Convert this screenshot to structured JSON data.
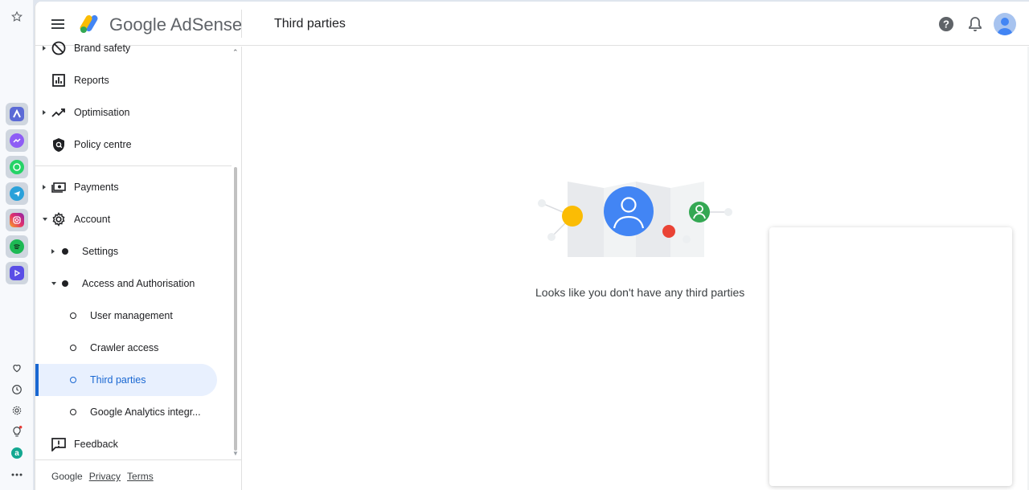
{
  "rail": {
    "apps": [
      {
        "icon": "adsense-app-icon",
        "color": "#5b6ad6"
      },
      {
        "icon": "messenger-icon",
        "color": "#8e5df5"
      },
      {
        "icon": "whatsapp-icon",
        "color": "#25d366"
      },
      {
        "icon": "telegram-icon",
        "color": "#2aa1da"
      },
      {
        "icon": "instagram-icon",
        "color": "#e1306c"
      },
      {
        "icon": "spotify-icon",
        "color": "#1db954"
      },
      {
        "icon": "player-icon",
        "color": "#5a4ee6"
      }
    ],
    "tools": [
      "heart-icon",
      "history-icon",
      "settings-icon",
      "bulb-icon",
      "aria-icon",
      "more-icon"
    ]
  },
  "header": {
    "brand": "Google AdSense",
    "page_title": "Third parties",
    "help_icon": "help-icon",
    "notifications_icon": "bell-icon",
    "avatar_icon": "avatar"
  },
  "sidebar": {
    "items": [
      {
        "label": "Brand safety",
        "icon": "block-icon",
        "expandable": true
      },
      {
        "label": "Reports",
        "icon": "reports-icon"
      },
      {
        "label": "Optimisation",
        "icon": "trending-icon",
        "expandable": true
      },
      {
        "label": "Policy centre",
        "icon": "shield-icon"
      },
      {
        "label": "Payments",
        "icon": "payments-icon",
        "expandable": true
      },
      {
        "label": "Account",
        "icon": "gear-icon",
        "expanded": true
      },
      {
        "label": "Settings",
        "expandable": true
      },
      {
        "label": "Access and Authorisation",
        "expanded": true
      },
      {
        "label": "User management"
      },
      {
        "label": "Crawler access"
      },
      {
        "label": "Third parties",
        "active": true
      },
      {
        "label": "Google Analytics integr..."
      },
      {
        "label": "Feedback",
        "icon": "feedback-icon"
      }
    ],
    "footer": {
      "brand": "Google",
      "privacy": "Privacy",
      "terms": "Terms"
    }
  },
  "main": {
    "empty_message": "Looks like you don't have any third parties"
  },
  "colors": {
    "accent": "#1967d2",
    "active_bg": "#e8f0fe",
    "person_blue": "#4285f4",
    "yellow": "#fbbc04",
    "red": "#ea4335",
    "green": "#34a853"
  }
}
